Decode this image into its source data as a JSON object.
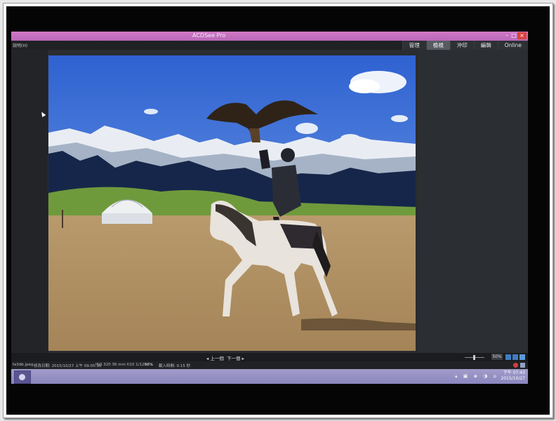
{
  "window": {
    "title": "ACDSee Pro"
  },
  "menu": {
    "item": "說明(H)"
  },
  "mode_tabs": [
    {
      "label": "管理",
      "active": false
    },
    {
      "label": "檢視",
      "active": true
    },
    {
      "label": "沖印",
      "active": false
    },
    {
      "label": "編輯",
      "active": false
    },
    {
      "label": "Online",
      "active": false
    }
  ],
  "navigation": {
    "prev_label": "◂ 上一個",
    "next_label": "下一個 ▸"
  },
  "zoom": {
    "value": "50%"
  },
  "status": {
    "filename": "fa3db.jpeg",
    "modified": "修改日期: 2015/10/27 上午 09:05:16",
    "exif": "ISO 320   36 mm   f/10   1/1250 s",
    "zoom": "60%",
    "load_time": "載入時間: 0.15 秒"
  },
  "taskbar": {
    "tray_icons": "▴ ▣ ◈ ◑ ⌂",
    "time": "下午 07:43",
    "date": "2015/10/27"
  },
  "colors": {
    "titlebar": "#c06fbd",
    "taskbar": "#9893c6",
    "active_tab": "#575b61",
    "sky": "#3f6fd6"
  },
  "photo": {
    "subject": "falconer-on-horse",
    "elements": [
      "eagle",
      "yurt",
      "snow-mountains",
      "forest",
      "meadow",
      "horse",
      "rider"
    ]
  }
}
